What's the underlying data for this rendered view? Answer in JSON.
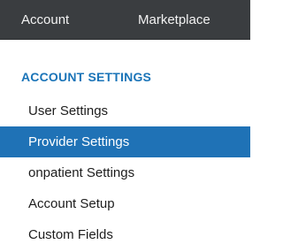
{
  "topnav": {
    "tabs": [
      {
        "label": "Account"
      },
      {
        "label": "Marketplace"
      }
    ]
  },
  "sidebar": {
    "section_title": "ACCOUNT SETTINGS",
    "items": [
      {
        "label": "User Settings",
        "active": false
      },
      {
        "label": "Provider Settings",
        "active": true
      },
      {
        "label": "onpatient Settings",
        "active": false
      },
      {
        "label": "Account Setup",
        "active": false
      },
      {
        "label": "Custom Fields",
        "active": false
      }
    ]
  },
  "colors": {
    "topbar_bg": "#3a3d40",
    "accent": "#1f72b6",
    "heading": "#1a74b8"
  }
}
